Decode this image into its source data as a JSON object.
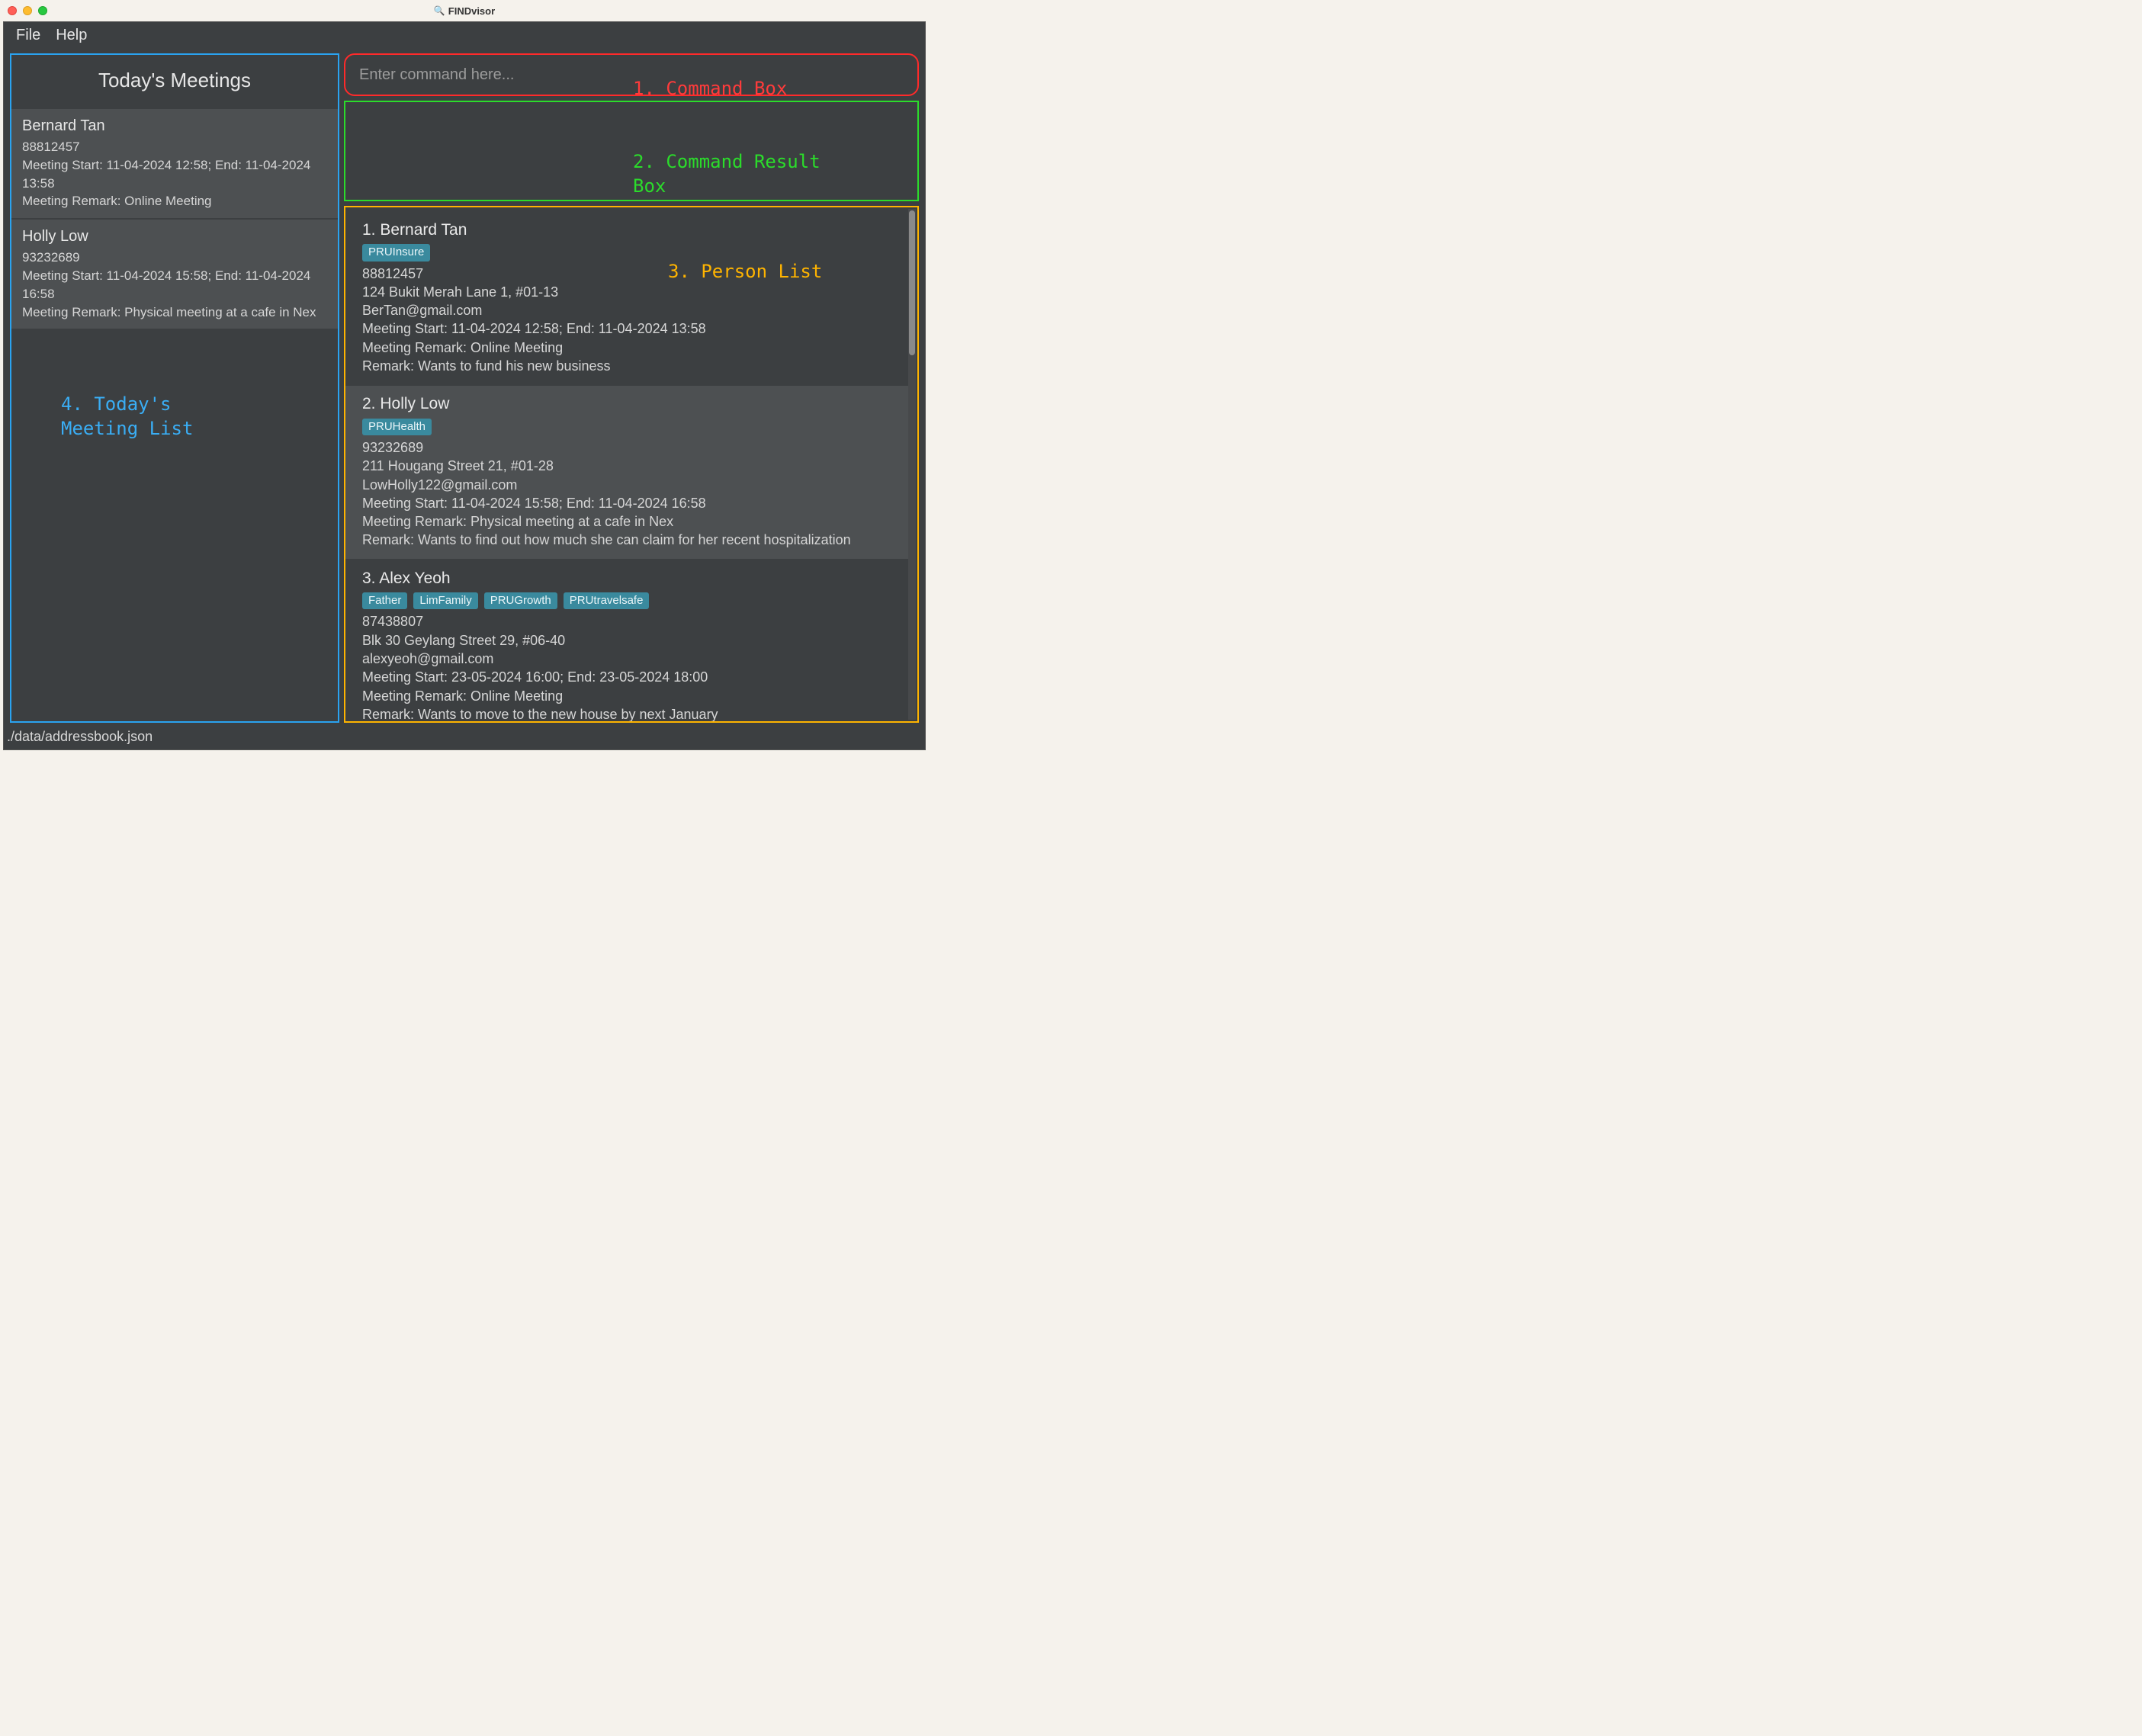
{
  "window": {
    "title": "FINDvisor"
  },
  "menubar": {
    "file": "File",
    "help": "Help"
  },
  "annotations": {
    "cmd": "1. Command Box",
    "result": "2. Command Result\nBox",
    "person": "3. Person List",
    "today": "4. Today's\nMeeting List"
  },
  "command_box": {
    "placeholder": "Enter command here..."
  },
  "today": {
    "title": "Today's Meetings",
    "items": [
      {
        "name": "Bernard Tan",
        "phone": "88812457",
        "meeting_time": "Meeting Start: 11-04-2024 12:58; End: 11-04-2024 13:58",
        "meeting_remark": "Meeting Remark: Online Meeting"
      },
      {
        "name": "Holly Low",
        "phone": "93232689",
        "meeting_time": "Meeting Start: 11-04-2024 15:58; End: 11-04-2024 16:58",
        "meeting_remark": "Meeting Remark: Physical meeting at a cafe in Nex"
      }
    ]
  },
  "persons": [
    {
      "index": "1.",
      "name": "Bernard Tan",
      "tags": [
        "PRUInsure"
      ],
      "phone": "88812457",
      "address": "124 Bukit Merah Lane 1, #01-13",
      "email": "BerTan@gmail.com",
      "meeting_time": "Meeting Start: 11-04-2024 12:58; End: 11-04-2024 13:58",
      "meeting_remark": "Meeting Remark: Online Meeting",
      "remark": "Remark: Wants to fund his new business",
      "alt": false
    },
    {
      "index": "2.",
      "name": "Holly Low",
      "tags": [
        "PRUHealth"
      ],
      "phone": "93232689",
      "address": "211 Hougang Street 21, #01-28",
      "email": "LowHolly122@gmail.com",
      "meeting_time": "Meeting Start: 11-04-2024 15:58; End: 11-04-2024 16:58",
      "meeting_remark": "Meeting Remark: Physical meeting at a cafe in Nex",
      "remark": "Remark: Wants to find out how much she can claim for her recent hospitalization",
      "alt": true
    },
    {
      "index": "3.",
      "name": "Alex Yeoh",
      "tags": [
        "Father",
        "LimFamily",
        "PRUGrowth",
        "PRUtravelsafe"
      ],
      "phone": "87438807",
      "address": "Blk 30 Geylang Street 29, #06-40",
      "email": "alexyeoh@gmail.com",
      "meeting_time": "Meeting Start: 23-05-2024 16:00; End: 23-05-2024 18:00",
      "meeting_remark": "Meeting Remark: Online Meeting",
      "remark": "Remark: Wants to move to the new house by next January",
      "alt": false
    }
  ],
  "statusbar": {
    "path": "./data/addressbook.json"
  }
}
